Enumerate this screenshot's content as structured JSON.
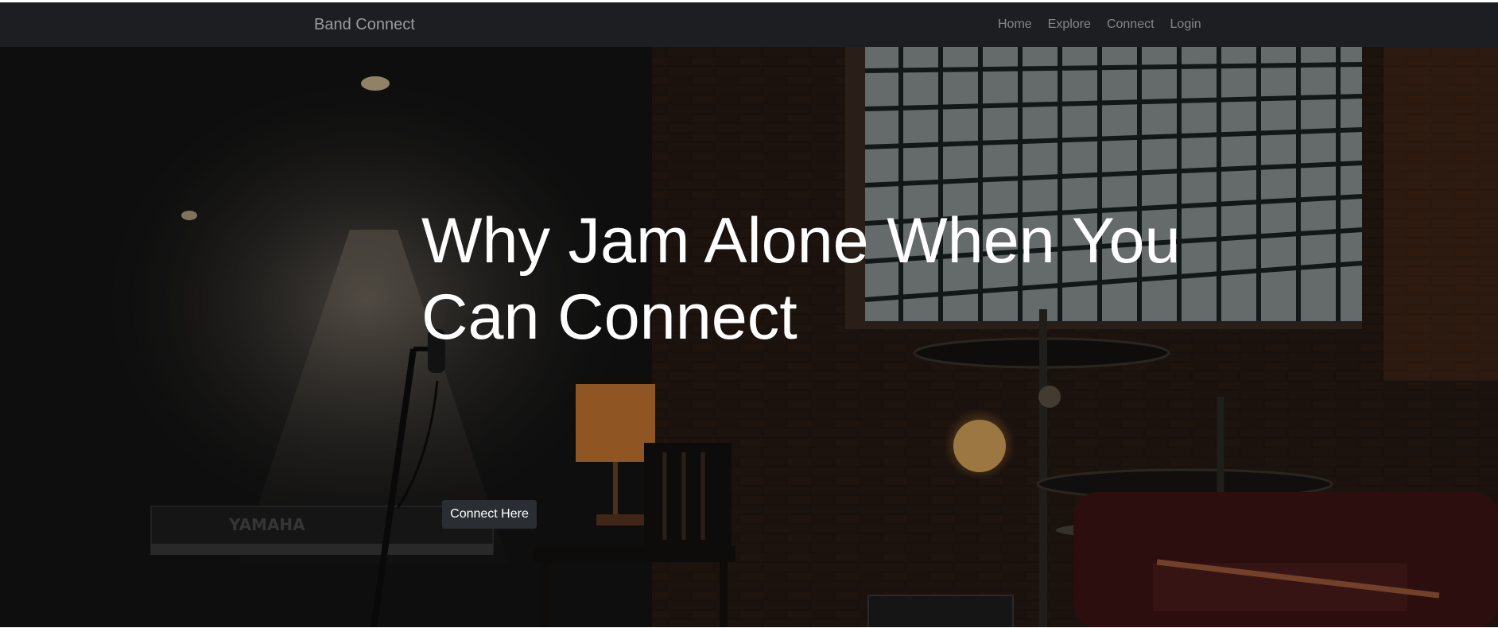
{
  "navbar": {
    "brand": "Band Connect",
    "links": [
      "Home",
      "Explore",
      "Connect",
      "Login"
    ]
  },
  "hero": {
    "headline": "Why Jam Alone When You Can Connect",
    "cta_label": "Connect Here",
    "background": {
      "description_icon": "music-stage-photo",
      "keyboard_brand": "YAMAHA"
    }
  },
  "colors": {
    "navbar_bg": "#1c1e21",
    "brand_text": "#9a9b9d",
    "nav_link": "#85878a",
    "button_bg": "#2a2e33",
    "headline": "#ffffff"
  }
}
